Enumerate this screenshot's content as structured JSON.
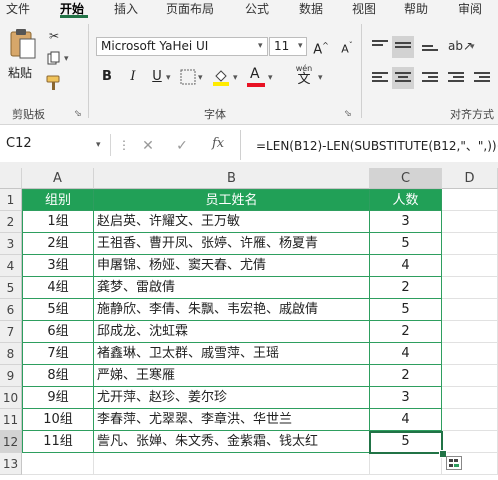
{
  "ribbon_tabs": [
    "文件",
    "开始",
    "插入",
    "页面布局",
    "公式",
    "数据",
    "视图",
    "帮助",
    "审阅"
  ],
  "active_tab": "开始",
  "clipboard": {
    "paste_label": "粘贴",
    "group_label": "剪贴板"
  },
  "font": {
    "name": "Microsoft YaHei UI",
    "size": "11",
    "group_label": "字体",
    "bold": "B",
    "italic": "I",
    "underline": "U",
    "wen": "wén",
    "wen_char": "文"
  },
  "alignment": {
    "group_label": "对齐方式"
  },
  "formula_bar": {
    "name_box": "C12",
    "fx": "fx",
    "formula": "=LEN(B12)-LEN(SUBSTITUTE(B12,\"、\",))+1"
  },
  "columns": [
    "A",
    "B",
    "C",
    "D"
  ],
  "row_numbers": [
    "1",
    "2",
    "3",
    "4",
    "5",
    "6",
    "7",
    "8",
    "9",
    "10",
    "11",
    "12",
    "13"
  ],
  "table": {
    "headers": [
      "组别",
      "员工姓名",
      "人数"
    ],
    "rows": [
      [
        "1组",
        "赵启英、许耀文、王万敏",
        "3"
      ],
      [
        "2组",
        "王祖香、曹开凤、张婷、许雁、杨夏青",
        "5"
      ],
      [
        "3组",
        "申屠锦、杨娅、窦天春、尤倩",
        "4"
      ],
      [
        "4组",
        "龚梦、雷啟倩",
        "2"
      ],
      [
        "5组",
        "施静欣、李倩、朱飘、韦宏艳、戚啟倩",
        "5"
      ],
      [
        "6组",
        "邱成龙、沈虹霖",
        "2"
      ],
      [
        "7组",
        "褚鑫琳、卫太群、戚雪萍、王瑶",
        "4"
      ],
      [
        "8组",
        "严娣、王寒雁",
        "2"
      ],
      [
        "9组",
        "尤开萍、赵珍、姜尔珍",
        "3"
      ],
      [
        "10组",
        "李春萍、尤翠翠、李章洪、华世兰",
        "4"
      ],
      [
        "11组",
        "訾凡、张婵、朱文秀、金紫霜、钱太红",
        "5"
      ]
    ]
  },
  "selected_cell": "C12",
  "colors": {
    "accent": "#217346",
    "header_fill": "#21a057",
    "border": "#2e9e5f",
    "font_color": "#e81123"
  }
}
